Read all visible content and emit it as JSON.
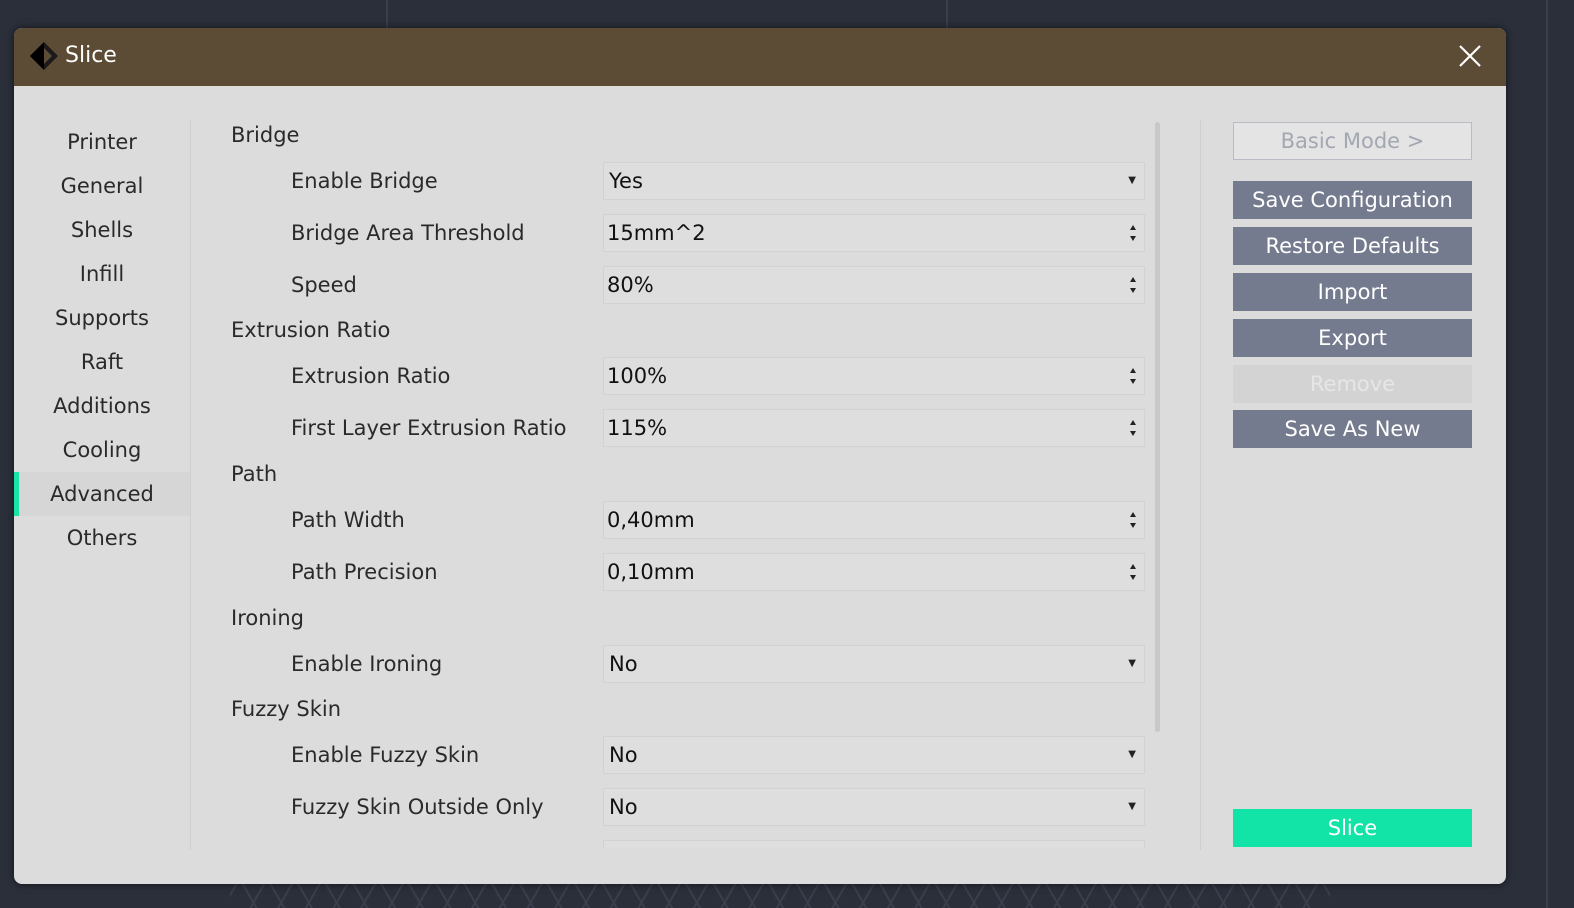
{
  "window": {
    "title": "Slice",
    "app_icon": "diamond-logo-icon",
    "close_icon": "close-icon"
  },
  "sidebar": {
    "items": [
      {
        "label": "Printer"
      },
      {
        "label": "General"
      },
      {
        "label": "Shells"
      },
      {
        "label": "Infill"
      },
      {
        "label": "Supports"
      },
      {
        "label": "Raft"
      },
      {
        "label": "Additions"
      },
      {
        "label": "Cooling"
      },
      {
        "label": "Advanced",
        "active": true
      },
      {
        "label": "Others"
      }
    ],
    "accent_color": "#19e3a5"
  },
  "settings": {
    "bridge": {
      "title": "Bridge",
      "enable_bridge": {
        "label": "Enable Bridge",
        "value": "Yes"
      },
      "area_threshold": {
        "label": "Bridge Area Threshold",
        "value": "15mm^2"
      },
      "speed": {
        "label": "Speed",
        "value": "80%"
      }
    },
    "extrusion": {
      "title": "Extrusion Ratio",
      "extrusion_ratio": {
        "label": "Extrusion Ratio",
        "value": "100%"
      },
      "first_layer_ratio": {
        "label": "First Layer Extrusion Ratio",
        "value": "115%"
      }
    },
    "path": {
      "title": "Path",
      "width": {
        "label": "Path Width",
        "value": "0,40mm"
      },
      "precision": {
        "label": "Path Precision",
        "value": "0,10mm"
      }
    },
    "ironing": {
      "title": "Ironing",
      "enable": {
        "label": "Enable Ironing",
        "value": "No"
      }
    },
    "fuzzy": {
      "title": "Fuzzy Skin",
      "enable": {
        "label": "Enable Fuzzy Skin",
        "value": "No"
      },
      "outside_only": {
        "label": "Fuzzy Skin Outside Only",
        "value": "No"
      }
    }
  },
  "actions": {
    "basic_mode": "Basic Mode >",
    "save_configuration": "Save Configuration",
    "restore_defaults": "Restore Defaults",
    "import": "Import",
    "export": "Export",
    "remove": "Remove",
    "save_as_new": "Save As New",
    "slice": "Slice"
  },
  "colors": {
    "titlebar": "#5c4c35",
    "button": "#757b8e",
    "slice_button": "#12e3a6"
  }
}
